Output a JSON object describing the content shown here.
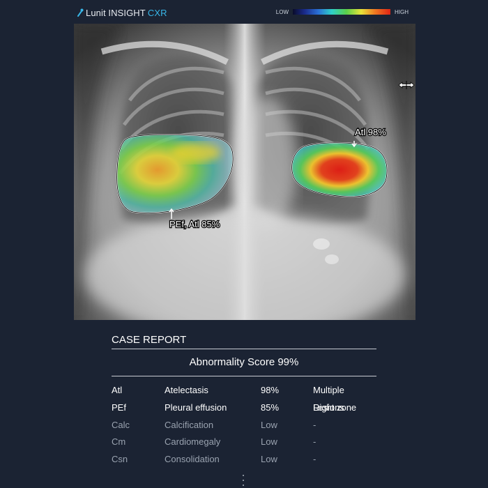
{
  "app": {
    "brand_name": "Lunit INSIGHT",
    "brand_product": "CXR",
    "scale_low": "LOW",
    "scale_high": "HIGH"
  },
  "viewer": {
    "lesions": [
      {
        "label": "Atl 98%",
        "intensity": "high"
      },
      {
        "label": "PEf, Atl 85%",
        "intensity": "medium"
      }
    ]
  },
  "report": {
    "title": "CASE REPORT",
    "abnormality_score": "Abnormality Score 99%",
    "findings": [
      {
        "abbr": "Atl",
        "name": "Atelectasis",
        "score": "98%",
        "location": "Multiple Lesions",
        "positive": true
      },
      {
        "abbr": "PEf",
        "name": "Pleural effusion",
        "score": "85%",
        "location": "Right zone",
        "positive": true
      },
      {
        "abbr": "Calc",
        "name": "Calcification",
        "score": "Low",
        "location": "-",
        "positive": false
      },
      {
        "abbr": "Cm",
        "name": "Cardiomegaly",
        "score": "Low",
        "location": "-",
        "positive": false
      },
      {
        "abbr": "Csn",
        "name": "Consolidation",
        "score": "Low",
        "location": "-",
        "positive": false
      }
    ]
  },
  "colors": {
    "background": "#1b2333",
    "brand_accent": "#38b6e8",
    "positive_text": "#ffffff",
    "negative_text": "#9aa3b0"
  }
}
